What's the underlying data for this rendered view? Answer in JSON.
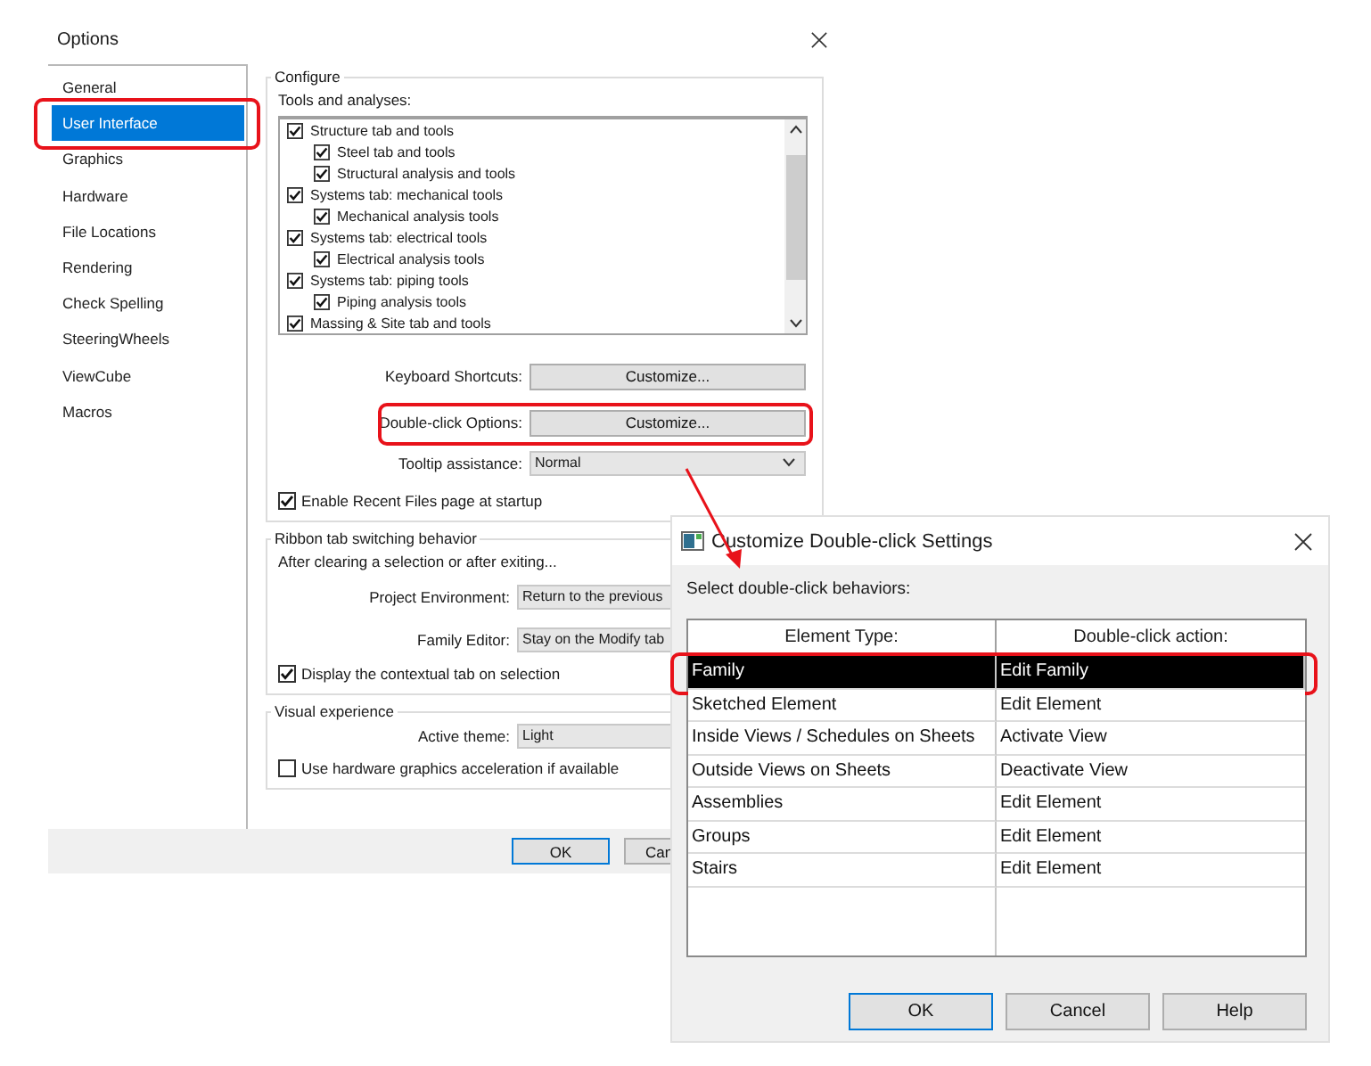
{
  "options_window": {
    "title": "Options",
    "sidebar": {
      "items": [
        {
          "label": "General",
          "selected": false,
          "highlighted": false
        },
        {
          "label": "User Interface",
          "selected": true,
          "highlighted": true
        },
        {
          "label": "Graphics",
          "selected": false,
          "highlighted": false
        },
        {
          "label": "Hardware",
          "selected": false,
          "highlighted": false
        },
        {
          "label": "File Locations",
          "selected": false,
          "highlighted": false
        },
        {
          "label": "Rendering",
          "selected": false,
          "highlighted": false
        },
        {
          "label": "Check Spelling",
          "selected": false,
          "highlighted": false
        },
        {
          "label": "SteeringWheels",
          "selected": false,
          "highlighted": false
        },
        {
          "label": "ViewCube",
          "selected": false,
          "highlighted": false
        },
        {
          "label": "Macros",
          "selected": false,
          "highlighted": false
        }
      ]
    },
    "configure": {
      "title": "Configure",
      "tools_label": "Tools and analyses:",
      "tools": [
        {
          "label": "Structure tab and tools",
          "checked": true,
          "children": [
            {
              "label": "Steel tab and tools",
              "checked": true
            },
            {
              "label": "Structural analysis and tools",
              "checked": true
            }
          ]
        },
        {
          "label": "Systems tab: mechanical tools",
          "checked": true,
          "children": [
            {
              "label": "Mechanical analysis tools",
              "checked": true
            }
          ]
        },
        {
          "label": "Systems tab: electrical tools",
          "checked": true,
          "children": [
            {
              "label": "Electrical analysis tools",
              "checked": true
            }
          ]
        },
        {
          "label": "Systems tab: piping tools",
          "checked": true,
          "children": [
            {
              "label": "Piping analysis tools",
              "checked": true
            }
          ]
        },
        {
          "label": "Massing & Site tab and tools",
          "checked": true
        }
      ],
      "keyboard_shortcuts": {
        "label": "Keyboard Shortcuts:",
        "button": "Customize..."
      },
      "double_click": {
        "label": "Double-click Options:",
        "button": "Customize...",
        "highlighted": true
      },
      "tooltip": {
        "label": "Tooltip assistance:",
        "value": "Normal"
      },
      "recent_files": {
        "label": "Enable Recent Files page at startup",
        "checked": true
      }
    },
    "ribbon": {
      "title": "Ribbon tab switching behavior",
      "note": "After clearing a selection or after exiting...",
      "project_environment": {
        "label": "Project Environment:",
        "value": "Return to the previous"
      },
      "family_editor": {
        "label": "Family Editor:",
        "value": "Stay on the Modify tab"
      },
      "contextual": {
        "label": "Display the contextual tab on selection",
        "checked": true
      }
    },
    "visual": {
      "title": "Visual experience",
      "theme": {
        "label": "Active theme:",
        "value": "Light"
      },
      "hardware": {
        "label": "Use hardware graphics acceleration if available",
        "checked": false
      }
    },
    "buttons": [
      {
        "label": "OK",
        "default": true
      },
      {
        "label": "Can",
        "default": false
      }
    ]
  },
  "double_click_dialog": {
    "title": "Customize Double-click Settings",
    "prompt": "Select double-click behaviors:",
    "columns": [
      "Element Type:",
      "Double-click action:"
    ],
    "rows": [
      {
        "element_type": "Family",
        "action": "Edit Family",
        "selected": true,
        "highlighted": true
      },
      {
        "element_type": "Sketched Element",
        "action": "Edit Element",
        "selected": false,
        "highlighted": false
      },
      {
        "element_type": "Inside Views / Schedules on Sheets",
        "action": "Activate View",
        "selected": false,
        "highlighted": false
      },
      {
        "element_type": "Outside Views on Sheets",
        "action": "Deactivate View",
        "selected": false,
        "highlighted": false
      },
      {
        "element_type": "Assemblies",
        "action": "Edit Element",
        "selected": false,
        "highlighted": false
      },
      {
        "element_type": "Groups",
        "action": "Edit Element",
        "selected": false,
        "highlighted": false
      },
      {
        "element_type": "Stairs",
        "action": "Edit Element",
        "selected": false,
        "highlighted": false
      }
    ],
    "buttons": [
      {
        "label": "OK",
        "default": true
      },
      {
        "label": "Cancel",
        "default": false
      },
      {
        "label": "Help",
        "default": false
      }
    ]
  }
}
